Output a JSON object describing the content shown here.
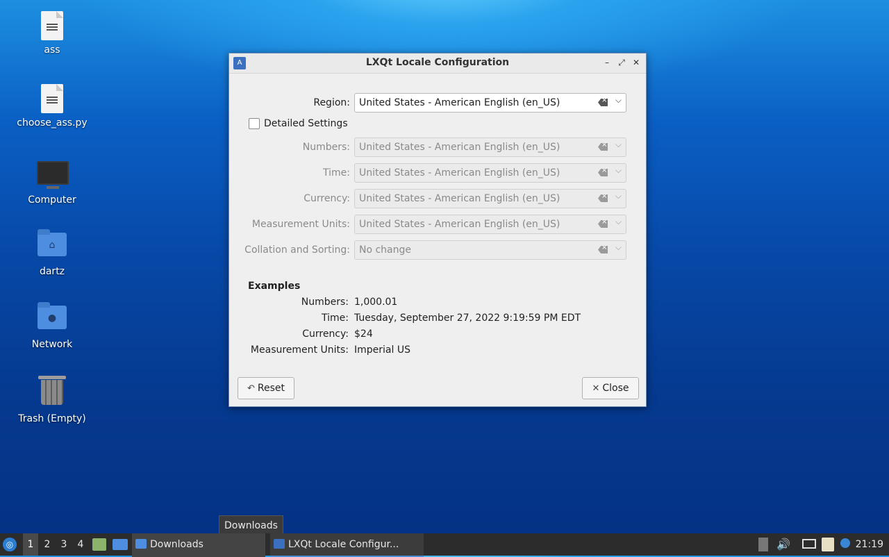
{
  "desktop": {
    "icons": [
      {
        "label": "ass",
        "icon": "text-file-icon"
      },
      {
        "label": "choose_ass.py",
        "icon": "text-file-icon"
      },
      {
        "label": "Computer",
        "icon": "computer-icon"
      },
      {
        "label": "dartz",
        "icon": "home-folder-icon"
      },
      {
        "label": "Network",
        "icon": "network-folder-icon"
      },
      {
        "label": "Trash (Empty)",
        "icon": "trash-icon"
      }
    ]
  },
  "dialog": {
    "title": "LXQt Locale Configuration",
    "region": {
      "label": "Region:",
      "value": "United States - American English (en_US)"
    },
    "detailed": {
      "label": "Detailed Settings",
      "checked": false
    },
    "fields": [
      {
        "label": "Numbers:",
        "value": "United States - American English (en_US)"
      },
      {
        "label": "Time:",
        "value": "United States - American English (en_US)"
      },
      {
        "label": "Currency:",
        "value": "United States - American English (en_US)"
      },
      {
        "label": "Measurement Units:",
        "value": "United States - American English (en_US)"
      },
      {
        "label": "Collation and Sorting:",
        "value": "No change"
      }
    ],
    "examples": {
      "title": "Examples",
      "rows": [
        {
          "label": "Numbers:",
          "value": "1,000.01"
        },
        {
          "label": "Time:",
          "value": "Tuesday, September 27, 2022 9:19:59 PM EDT"
        },
        {
          "label": "Currency:",
          "value": "$24"
        },
        {
          "label": "Measurement Units:",
          "value": "Imperial US"
        }
      ]
    },
    "buttons": {
      "reset": "Reset",
      "close": "Close"
    }
  },
  "tooltip": "Downloads",
  "taskbar": {
    "desktops": [
      "1",
      "2",
      "3",
      "4"
    ],
    "active_desktop": "1",
    "tasks": [
      {
        "label": "Downloads",
        "icon": "folder-icon"
      },
      {
        "label": "LXQt Locale Configur...",
        "icon": "locale-app-icon"
      }
    ],
    "clock": "21:19"
  },
  "colors": {
    "accent": "#4b8ed8",
    "taskbar": "#2c2c2c",
    "dialog_bg": "#efefef"
  }
}
